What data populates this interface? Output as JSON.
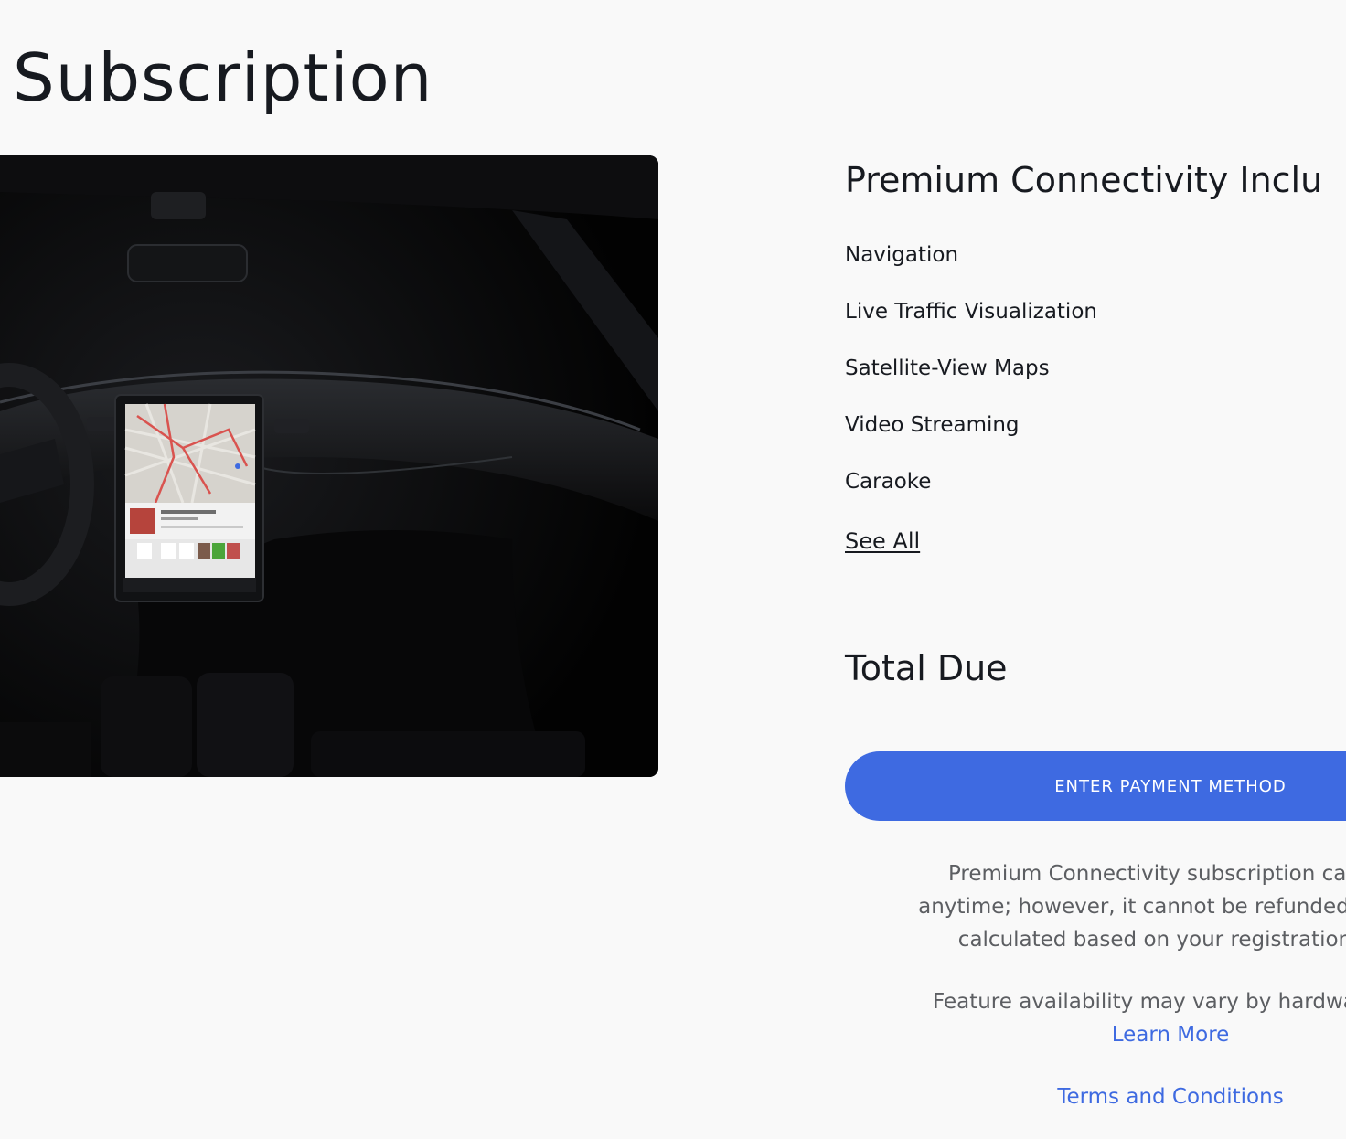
{
  "page": {
    "title": "Subscription"
  },
  "hero_image": {
    "alt_name": "car-interior-image"
  },
  "features": {
    "title": "Premium Connectivity Inclu",
    "items": [
      "Navigation",
      "Live Traffic Visualization",
      "Satellite-View Maps",
      "Video Streaming",
      "Caraoke"
    ],
    "see_all_label": "See All"
  },
  "total": {
    "title": "Total Due"
  },
  "payment": {
    "button_label": "ENTER PAYMENT METHOD"
  },
  "disclaimer": {
    "lines": [
      "Premium Connectivity subscription can be",
      "anytime; however, it cannot be refunded. If app",
      "calculated based on your registration ac"
    ]
  },
  "availability": {
    "text": "Feature availability may vary by hardware co",
    "learn_more_label": "Learn More"
  },
  "terms": {
    "label": "Terms and Conditions"
  },
  "colors": {
    "accent": "#3e6ae1",
    "background": "#f9f9f9",
    "text_primary": "#171a20",
    "text_secondary": "#5c5e62"
  }
}
